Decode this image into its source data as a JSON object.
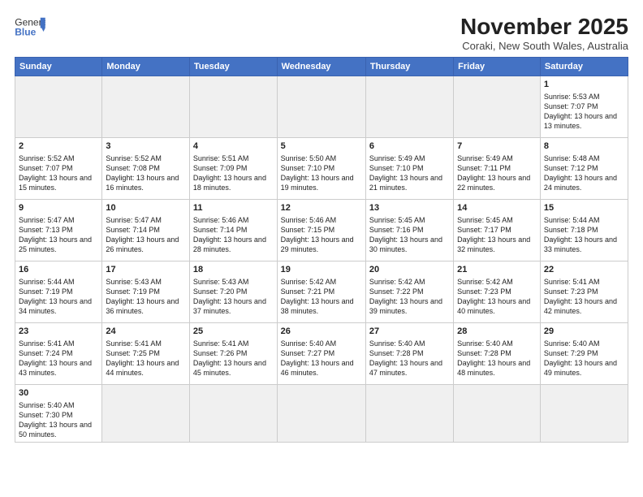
{
  "header": {
    "logo_general": "General",
    "logo_blue": "Blue",
    "month_title": "November 2025",
    "subtitle": "Coraki, New South Wales, Australia"
  },
  "days_of_week": [
    "Sunday",
    "Monday",
    "Tuesday",
    "Wednesday",
    "Thursday",
    "Friday",
    "Saturday"
  ],
  "weeks": [
    [
      {
        "day": "",
        "info": ""
      },
      {
        "day": "",
        "info": ""
      },
      {
        "day": "",
        "info": ""
      },
      {
        "day": "",
        "info": ""
      },
      {
        "day": "",
        "info": ""
      },
      {
        "day": "",
        "info": ""
      },
      {
        "day": "1",
        "info": "Sunrise: 5:53 AM\nSunset: 7:07 PM\nDaylight: 13 hours and 13 minutes."
      }
    ],
    [
      {
        "day": "2",
        "info": "Sunrise: 5:52 AM\nSunset: 7:07 PM\nDaylight: 13 hours and 15 minutes."
      },
      {
        "day": "3",
        "info": "Sunrise: 5:52 AM\nSunset: 7:08 PM\nDaylight: 13 hours and 16 minutes."
      },
      {
        "day": "4",
        "info": "Sunrise: 5:51 AM\nSunset: 7:09 PM\nDaylight: 13 hours and 18 minutes."
      },
      {
        "day": "5",
        "info": "Sunrise: 5:50 AM\nSunset: 7:10 PM\nDaylight: 13 hours and 19 minutes."
      },
      {
        "day": "6",
        "info": "Sunrise: 5:49 AM\nSunset: 7:10 PM\nDaylight: 13 hours and 21 minutes."
      },
      {
        "day": "7",
        "info": "Sunrise: 5:49 AM\nSunset: 7:11 PM\nDaylight: 13 hours and 22 minutes."
      },
      {
        "day": "8",
        "info": "Sunrise: 5:48 AM\nSunset: 7:12 PM\nDaylight: 13 hours and 24 minutes."
      }
    ],
    [
      {
        "day": "9",
        "info": "Sunrise: 5:47 AM\nSunset: 7:13 PM\nDaylight: 13 hours and 25 minutes."
      },
      {
        "day": "10",
        "info": "Sunrise: 5:47 AM\nSunset: 7:14 PM\nDaylight: 13 hours and 26 minutes."
      },
      {
        "day": "11",
        "info": "Sunrise: 5:46 AM\nSunset: 7:14 PM\nDaylight: 13 hours and 28 minutes."
      },
      {
        "day": "12",
        "info": "Sunrise: 5:46 AM\nSunset: 7:15 PM\nDaylight: 13 hours and 29 minutes."
      },
      {
        "day": "13",
        "info": "Sunrise: 5:45 AM\nSunset: 7:16 PM\nDaylight: 13 hours and 30 minutes."
      },
      {
        "day": "14",
        "info": "Sunrise: 5:45 AM\nSunset: 7:17 PM\nDaylight: 13 hours and 32 minutes."
      },
      {
        "day": "15",
        "info": "Sunrise: 5:44 AM\nSunset: 7:18 PM\nDaylight: 13 hours and 33 minutes."
      }
    ],
    [
      {
        "day": "16",
        "info": "Sunrise: 5:44 AM\nSunset: 7:19 PM\nDaylight: 13 hours and 34 minutes."
      },
      {
        "day": "17",
        "info": "Sunrise: 5:43 AM\nSunset: 7:19 PM\nDaylight: 13 hours and 36 minutes."
      },
      {
        "day": "18",
        "info": "Sunrise: 5:43 AM\nSunset: 7:20 PM\nDaylight: 13 hours and 37 minutes."
      },
      {
        "day": "19",
        "info": "Sunrise: 5:42 AM\nSunset: 7:21 PM\nDaylight: 13 hours and 38 minutes."
      },
      {
        "day": "20",
        "info": "Sunrise: 5:42 AM\nSunset: 7:22 PM\nDaylight: 13 hours and 39 minutes."
      },
      {
        "day": "21",
        "info": "Sunrise: 5:42 AM\nSunset: 7:23 PM\nDaylight: 13 hours and 40 minutes."
      },
      {
        "day": "22",
        "info": "Sunrise: 5:41 AM\nSunset: 7:23 PM\nDaylight: 13 hours and 42 minutes."
      }
    ],
    [
      {
        "day": "23",
        "info": "Sunrise: 5:41 AM\nSunset: 7:24 PM\nDaylight: 13 hours and 43 minutes."
      },
      {
        "day": "24",
        "info": "Sunrise: 5:41 AM\nSunset: 7:25 PM\nDaylight: 13 hours and 44 minutes."
      },
      {
        "day": "25",
        "info": "Sunrise: 5:41 AM\nSunset: 7:26 PM\nDaylight: 13 hours and 45 minutes."
      },
      {
        "day": "26",
        "info": "Sunrise: 5:40 AM\nSunset: 7:27 PM\nDaylight: 13 hours and 46 minutes."
      },
      {
        "day": "27",
        "info": "Sunrise: 5:40 AM\nSunset: 7:28 PM\nDaylight: 13 hours and 47 minutes."
      },
      {
        "day": "28",
        "info": "Sunrise: 5:40 AM\nSunset: 7:28 PM\nDaylight: 13 hours and 48 minutes."
      },
      {
        "day": "29",
        "info": "Sunrise: 5:40 AM\nSunset: 7:29 PM\nDaylight: 13 hours and 49 minutes."
      }
    ],
    [
      {
        "day": "30",
        "info": "Sunrise: 5:40 AM\nSunset: 7:30 PM\nDaylight: 13 hours and 50 minutes."
      },
      {
        "day": "",
        "info": ""
      },
      {
        "day": "",
        "info": ""
      },
      {
        "day": "",
        "info": ""
      },
      {
        "day": "",
        "info": ""
      },
      {
        "day": "",
        "info": ""
      },
      {
        "day": "",
        "info": ""
      }
    ]
  ]
}
